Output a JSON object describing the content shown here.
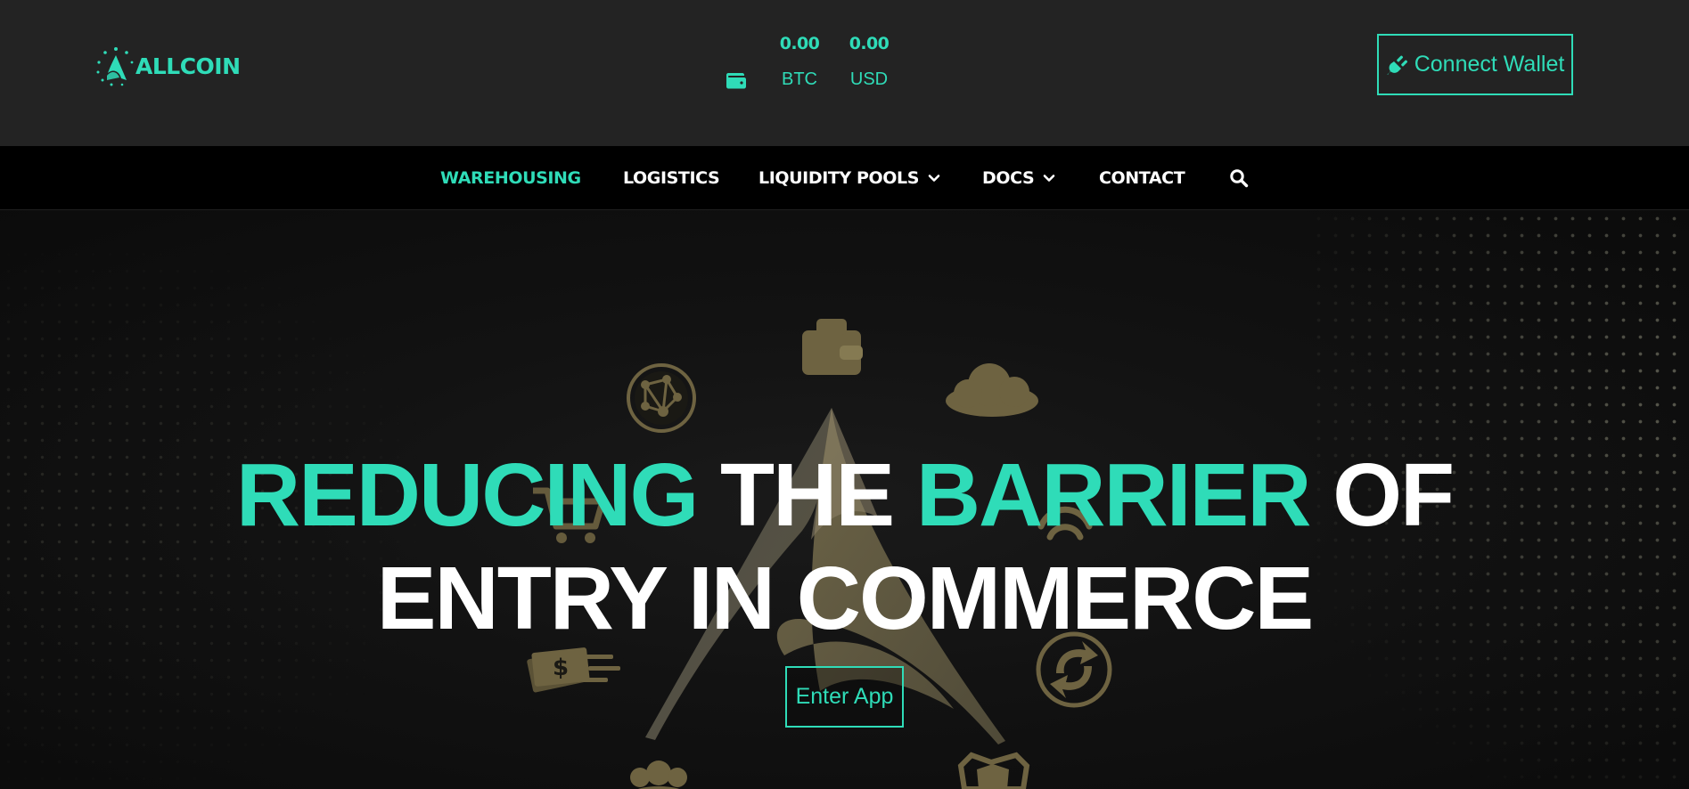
{
  "brand": {
    "name": "ALLCOIN"
  },
  "header": {
    "balances": [
      {
        "amount": "0.00",
        "unit": "BTC"
      },
      {
        "amount": "0.00",
        "unit": "USD"
      }
    ],
    "connect_label": "Connect Wallet"
  },
  "nav": {
    "items": [
      {
        "label": "WAREHOUSING",
        "active": true,
        "dropdown": false
      },
      {
        "label": "LOGISTICS",
        "active": false,
        "dropdown": false
      },
      {
        "label": "LIQUIDITY POOLS",
        "active": false,
        "dropdown": true
      },
      {
        "label": "DOCS",
        "active": false,
        "dropdown": true
      },
      {
        "label": "CONTACT",
        "active": false,
        "dropdown": false
      }
    ]
  },
  "hero": {
    "headline": {
      "word1": "REDUCING",
      "word2": "THE",
      "word3": "BARRIER",
      "word4": "OF",
      "line2": "ENTRY IN COMMERCE"
    },
    "cta_label": "Enter App"
  },
  "colors": {
    "accent": "#2fdcb8",
    "topbar_bg": "#232323",
    "nav_bg": "#000000",
    "hero_gold": "#6e6341"
  },
  "icons": [
    "logo-icon",
    "wallet-icon",
    "plug-icon",
    "chevron-down-icon",
    "search-icon"
  ]
}
